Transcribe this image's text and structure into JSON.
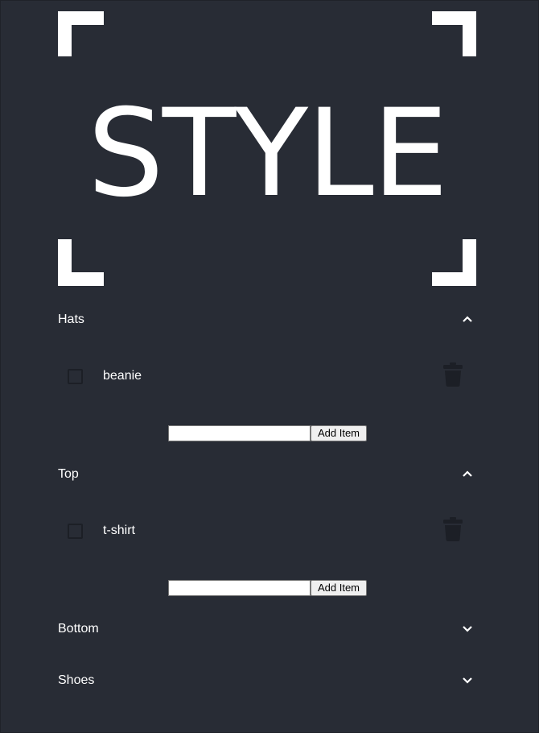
{
  "logo": {
    "text": "STYLE"
  },
  "colors": {
    "background": "#282c35",
    "text": "#ffffff",
    "icon_dark": "#1c1f26"
  },
  "categories": [
    {
      "title": "Hats",
      "expanded": true,
      "chevron_icon": "chevron-up-icon",
      "items": [
        {
          "label": "beanie",
          "checked": false
        }
      ],
      "add_button_label": "Add Item",
      "input_value": ""
    },
    {
      "title": "Top",
      "expanded": true,
      "chevron_icon": "chevron-up-icon",
      "items": [
        {
          "label": "t-shirt",
          "checked": false
        }
      ],
      "add_button_label": "Add Item",
      "input_value": ""
    },
    {
      "title": "Bottom",
      "expanded": false,
      "chevron_icon": "chevron-down-icon"
    },
    {
      "title": "Shoes",
      "expanded": false,
      "chevron_icon": "chevron-down-icon"
    }
  ]
}
